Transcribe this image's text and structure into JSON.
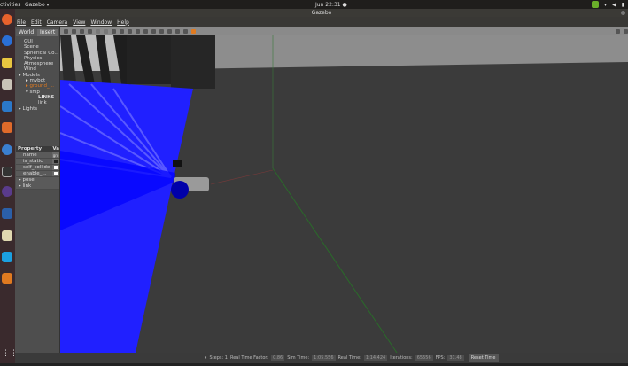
{
  "topbar": {
    "activities": "ctivities",
    "app": "Gazebo ▾",
    "clock": "Jun 22:31 ●"
  },
  "window": {
    "title": "Gazebo"
  },
  "menu": [
    "File",
    "Edit",
    "Camera",
    "View",
    "Window",
    "Help"
  ],
  "left_panel": {
    "tabs": [
      "World",
      "Insert"
    ],
    "tree": [
      "GUI",
      "Scene",
      "Spherical Co...",
      "Physics",
      "Atmosphere",
      "Wind",
      "▾ Models",
      "▸ mybot",
      "▸ ground_...",
      "▾ ship",
      "LINKS",
      "link",
      "▸ Lights"
    ],
    "properties": {
      "header": "Property",
      "value_header": "Va",
      "rows": [
        {
          "key": "name",
          "value": "gro"
        },
        {
          "key": "is_static",
          "value": ""
        },
        {
          "key": "self_collide",
          "value": ""
        },
        {
          "key": "enable_...",
          "value": ""
        }
      ],
      "groups": [
        "▸ pose",
        "▸ link"
      ]
    }
  },
  "status": {
    "pause": "⏸",
    "steps_label": "Steps: 1",
    "rtf_label": "Real Time Factor:",
    "rtf": "0.86",
    "sim_label": "Sim Time:",
    "sim": "1:05.556",
    "real_label": "Real Time:",
    "real": "1:14.424",
    "iter_label": "Iterations:",
    "iter": "65556",
    "fps_label": "FPS:",
    "fps": "31.48",
    "reset": "Reset Time"
  },
  "colors": {
    "laser": "#0000ff",
    "ground": "#3a3a3a",
    "selected": "#e07a20"
  }
}
